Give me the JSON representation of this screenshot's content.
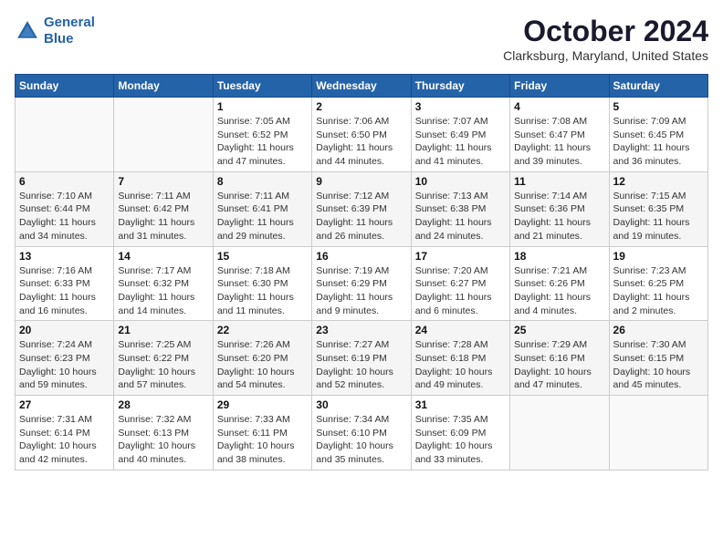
{
  "header": {
    "logo_line1": "General",
    "logo_line2": "Blue",
    "month": "October 2024",
    "location": "Clarksburg, Maryland, United States"
  },
  "weekdays": [
    "Sunday",
    "Monday",
    "Tuesday",
    "Wednesday",
    "Thursday",
    "Friday",
    "Saturday"
  ],
  "weeks": [
    [
      {
        "day": "",
        "detail": ""
      },
      {
        "day": "",
        "detail": ""
      },
      {
        "day": "1",
        "detail": "Sunrise: 7:05 AM\nSunset: 6:52 PM\nDaylight: 11 hours and 47 minutes."
      },
      {
        "day": "2",
        "detail": "Sunrise: 7:06 AM\nSunset: 6:50 PM\nDaylight: 11 hours and 44 minutes."
      },
      {
        "day": "3",
        "detail": "Sunrise: 7:07 AM\nSunset: 6:49 PM\nDaylight: 11 hours and 41 minutes."
      },
      {
        "day": "4",
        "detail": "Sunrise: 7:08 AM\nSunset: 6:47 PM\nDaylight: 11 hours and 39 minutes."
      },
      {
        "day": "5",
        "detail": "Sunrise: 7:09 AM\nSunset: 6:45 PM\nDaylight: 11 hours and 36 minutes."
      }
    ],
    [
      {
        "day": "6",
        "detail": "Sunrise: 7:10 AM\nSunset: 6:44 PM\nDaylight: 11 hours and 34 minutes."
      },
      {
        "day": "7",
        "detail": "Sunrise: 7:11 AM\nSunset: 6:42 PM\nDaylight: 11 hours and 31 minutes."
      },
      {
        "day": "8",
        "detail": "Sunrise: 7:11 AM\nSunset: 6:41 PM\nDaylight: 11 hours and 29 minutes."
      },
      {
        "day": "9",
        "detail": "Sunrise: 7:12 AM\nSunset: 6:39 PM\nDaylight: 11 hours and 26 minutes."
      },
      {
        "day": "10",
        "detail": "Sunrise: 7:13 AM\nSunset: 6:38 PM\nDaylight: 11 hours and 24 minutes."
      },
      {
        "day": "11",
        "detail": "Sunrise: 7:14 AM\nSunset: 6:36 PM\nDaylight: 11 hours and 21 minutes."
      },
      {
        "day": "12",
        "detail": "Sunrise: 7:15 AM\nSunset: 6:35 PM\nDaylight: 11 hours and 19 minutes."
      }
    ],
    [
      {
        "day": "13",
        "detail": "Sunrise: 7:16 AM\nSunset: 6:33 PM\nDaylight: 11 hours and 16 minutes."
      },
      {
        "day": "14",
        "detail": "Sunrise: 7:17 AM\nSunset: 6:32 PM\nDaylight: 11 hours and 14 minutes."
      },
      {
        "day": "15",
        "detail": "Sunrise: 7:18 AM\nSunset: 6:30 PM\nDaylight: 11 hours and 11 minutes."
      },
      {
        "day": "16",
        "detail": "Sunrise: 7:19 AM\nSunset: 6:29 PM\nDaylight: 11 hours and 9 minutes."
      },
      {
        "day": "17",
        "detail": "Sunrise: 7:20 AM\nSunset: 6:27 PM\nDaylight: 11 hours and 6 minutes."
      },
      {
        "day": "18",
        "detail": "Sunrise: 7:21 AM\nSunset: 6:26 PM\nDaylight: 11 hours and 4 minutes."
      },
      {
        "day": "19",
        "detail": "Sunrise: 7:23 AM\nSunset: 6:25 PM\nDaylight: 11 hours and 2 minutes."
      }
    ],
    [
      {
        "day": "20",
        "detail": "Sunrise: 7:24 AM\nSunset: 6:23 PM\nDaylight: 10 hours and 59 minutes."
      },
      {
        "day": "21",
        "detail": "Sunrise: 7:25 AM\nSunset: 6:22 PM\nDaylight: 10 hours and 57 minutes."
      },
      {
        "day": "22",
        "detail": "Sunrise: 7:26 AM\nSunset: 6:20 PM\nDaylight: 10 hours and 54 minutes."
      },
      {
        "day": "23",
        "detail": "Sunrise: 7:27 AM\nSunset: 6:19 PM\nDaylight: 10 hours and 52 minutes."
      },
      {
        "day": "24",
        "detail": "Sunrise: 7:28 AM\nSunset: 6:18 PM\nDaylight: 10 hours and 49 minutes."
      },
      {
        "day": "25",
        "detail": "Sunrise: 7:29 AM\nSunset: 6:16 PM\nDaylight: 10 hours and 47 minutes."
      },
      {
        "day": "26",
        "detail": "Sunrise: 7:30 AM\nSunset: 6:15 PM\nDaylight: 10 hours and 45 minutes."
      }
    ],
    [
      {
        "day": "27",
        "detail": "Sunrise: 7:31 AM\nSunset: 6:14 PM\nDaylight: 10 hours and 42 minutes."
      },
      {
        "day": "28",
        "detail": "Sunrise: 7:32 AM\nSunset: 6:13 PM\nDaylight: 10 hours and 40 minutes."
      },
      {
        "day": "29",
        "detail": "Sunrise: 7:33 AM\nSunset: 6:11 PM\nDaylight: 10 hours and 38 minutes."
      },
      {
        "day": "30",
        "detail": "Sunrise: 7:34 AM\nSunset: 6:10 PM\nDaylight: 10 hours and 35 minutes."
      },
      {
        "day": "31",
        "detail": "Sunrise: 7:35 AM\nSunset: 6:09 PM\nDaylight: 10 hours and 33 minutes."
      },
      {
        "day": "",
        "detail": ""
      },
      {
        "day": "",
        "detail": ""
      }
    ]
  ]
}
